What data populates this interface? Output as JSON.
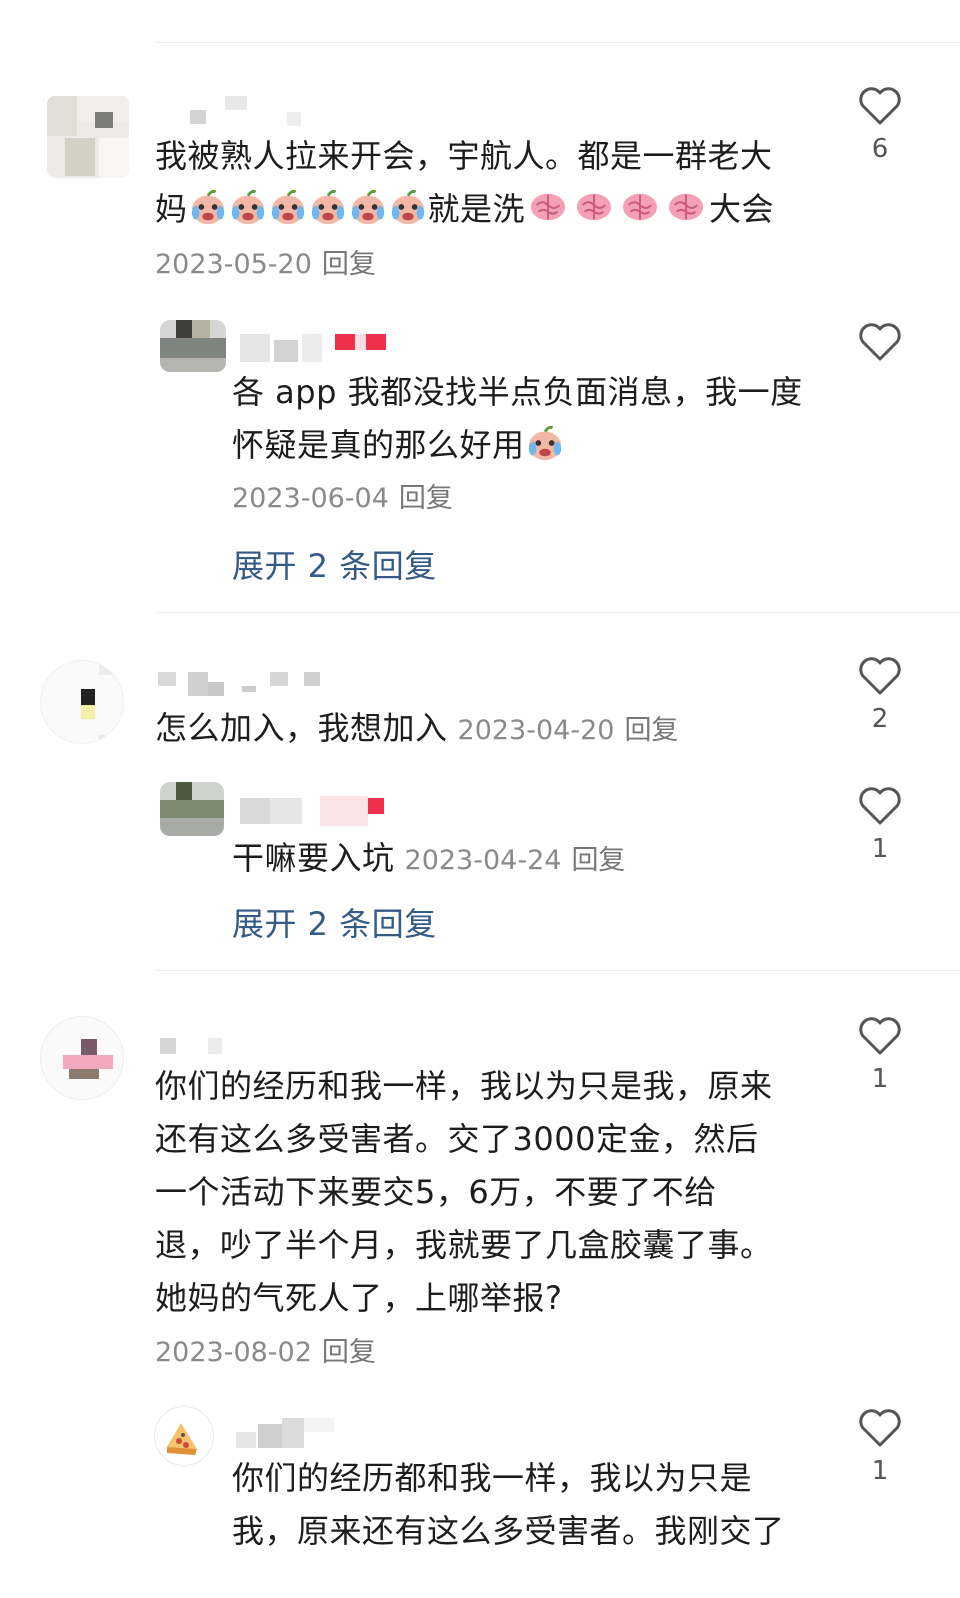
{
  "comments": [
    {
      "text_line1": "我被熟人拉来开会，宇航人。都是一群老大",
      "text_prefix2": "妈",
      "text_mid2": "就是洗",
      "text_suffix2": "大会",
      "date": "2023-05-20",
      "reply": "回复",
      "likes": "6",
      "sub": {
        "text_line1": "各 app 我都没找半点负面消息，我一度",
        "text_line2": "怀疑是真的那么好用",
        "date": "2023-06-04",
        "reply": "回复",
        "likes": ""
      },
      "expand": "展开 2 条回复"
    },
    {
      "text": "怎么加入，我想加入",
      "date": "2023-04-20",
      "reply": "回复",
      "likes": "2",
      "sub": {
        "text": "干嘛要入坑",
        "date": "2023-04-24",
        "reply": "回复",
        "likes": "1"
      },
      "expand": "展开 2 条回复"
    },
    {
      "lines": [
        "你们的经历和我一样，我以为只是我，原来",
        "还有这么多受害者。交了3000定金，然后",
        "一个活动下来要交5，6万，不要了不给",
        "退，吵了半个月，我就要了几盒胶囊了事。",
        "她妈的气死人了，上哪举报?"
      ],
      "date": "2023-08-02",
      "reply": "回复",
      "likes": "1",
      "sub": {
        "lines": [
          "你们的经历都和我一样，我以为只是",
          "我，原来还有这么多受害者。我刚交了"
        ],
        "likes": "1"
      }
    }
  ],
  "icons": {
    "like": "heart-outline-icon",
    "cry": "crying-face-emoji",
    "brain": "brain-emoji"
  },
  "colors": {
    "link": "#355a86",
    "meta": "#8a8a8a",
    "text": "#1d1d1d",
    "censor_red": "#f0304a"
  }
}
